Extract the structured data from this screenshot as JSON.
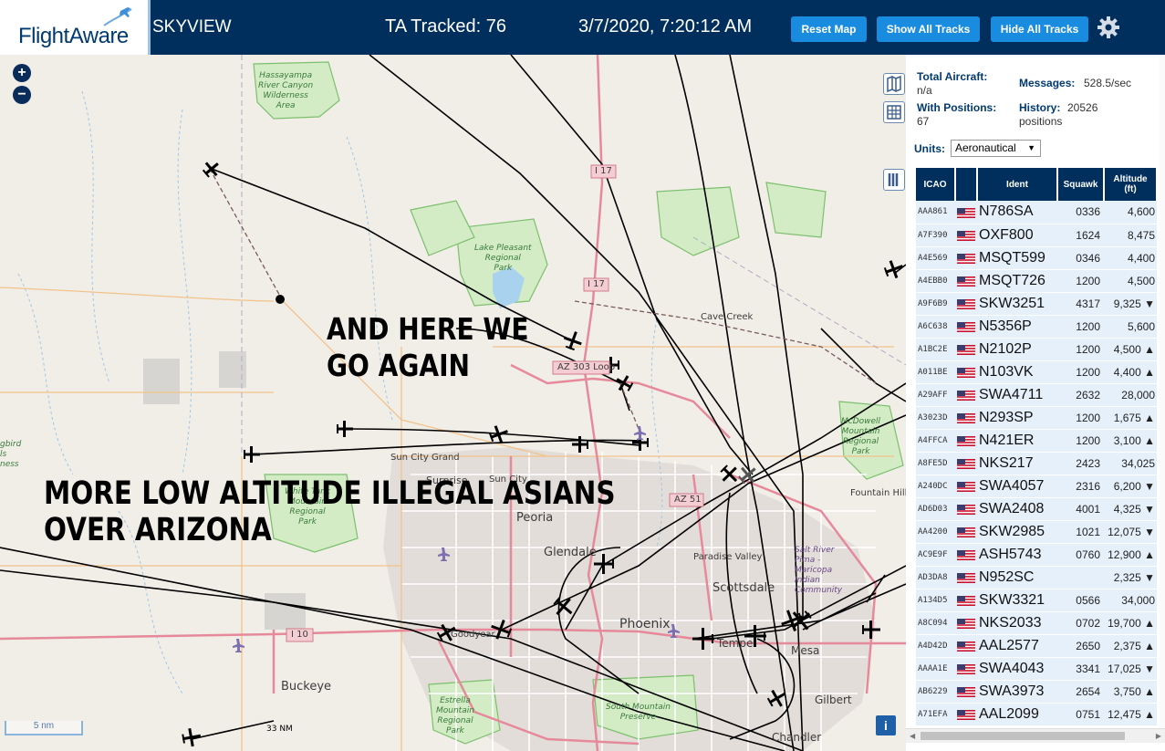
{
  "header": {
    "logo_text": "FlightAware",
    "app_name": "SKYVIEW",
    "tracked": "TA Tracked: 76",
    "datetime": "3/7/2020, 7:20:12 AM",
    "buttons": {
      "reset": "Reset Map",
      "show_all": "Show All Tracks",
      "hide_all": "Hide All Tracks"
    },
    "icons": {
      "settings": "gear-icon",
      "logo": "airplane-icon"
    }
  },
  "map": {
    "zoom_in": "+",
    "zoom_out": "−",
    "scale": "5 nm",
    "info": "i",
    "overlay_text_1": "AND HERE WE\nGO AGAIN",
    "overlay_text_2": "MORE LOW ALTITUDE ILLEGAL ASIANS\nOVER ARIZONA",
    "place_labels": {
      "cave_creek": "Cave Creek",
      "sun_city_grand": "Sun City Grand",
      "surprise": "Surprise",
      "sun_city": "Sun City",
      "peoria": "Peoria",
      "glendale": "Glendale",
      "paradise_valley": "Paradise Valley",
      "scottsdale": "Scottsdale",
      "phoenix": "Phoenix",
      "tempe": "Tempe",
      "mesa": "Mesa",
      "gilbert": "Gilbert",
      "chandler": "Chandler",
      "buckeye": "Buckeye",
      "goodyear": "Goodyear",
      "fountain_hills": "Fountain Hill",
      "salt_river": "Salt River\nPima -\nMaricopa\nIndian\nCommunity",
      "mileage": "33 NM"
    },
    "park_labels": {
      "hassayampa": "Hassayampa\nRiver Canyon\nWilderness\nArea",
      "lake_pleasant": "Lake Pleasant\nRegional\nPark",
      "white_tank": "White Tank\nMountain\nRegional\nPark",
      "mcdowell": "McDowell\nMountain\nRegional\nPark",
      "estrella": "Estrella\nMountain\nRegional\nPark",
      "south_mountain": "South Mountain\nPreserve",
      "skybird": "gbird\nls\nness"
    },
    "road_labels": {
      "i17_north": "I 17",
      "i17": "I 17",
      "az303": "AZ 303 Loop",
      "az51": "AZ 51",
      "i10": "I 10"
    }
  },
  "sidebar": {
    "total_aircraft_label": "Total Aircraft:",
    "total_aircraft_value": "n/a",
    "with_positions_label": "With Positions:",
    "with_positions_value": "67",
    "messages_label": "Messages:",
    "messages_value": "528.5/sec",
    "history_label": "History:",
    "history_value": "20526",
    "history_unit": "positions",
    "units_label": "Units:",
    "units_value": "Aeronautical",
    "table": {
      "headers": {
        "icao": "ICAO",
        "flag": "",
        "ident": "Ident",
        "squawk": "Squawk",
        "altitude": "Altitude\n(ft)"
      },
      "rows": [
        {
          "icao": "AAA861",
          "ident": "N786SA",
          "squawk": "0336",
          "altitude": "4,600"
        },
        {
          "icao": "A7F390",
          "ident": "OXF800",
          "squawk": "1624",
          "altitude": "8,475"
        },
        {
          "icao": "A4E569",
          "ident": "MSQT599",
          "squawk": "0346",
          "altitude": "4,400"
        },
        {
          "icao": "A4EBB0",
          "ident": "MSQT726",
          "squawk": "1200",
          "altitude": "4,500"
        },
        {
          "icao": "A9F6B9",
          "ident": "SKW3251",
          "squawk": "4317",
          "altitude": "9,325 ▼"
        },
        {
          "icao": "A6C638",
          "ident": "N5356P",
          "squawk": "1200",
          "altitude": "5,600"
        },
        {
          "icao": "A1BC2E",
          "ident": "N2102P",
          "squawk": "1200",
          "altitude": "4,500 ▲"
        },
        {
          "icao": "A011BE",
          "ident": "N103VK",
          "squawk": "1200",
          "altitude": "4,400 ▲"
        },
        {
          "icao": "A29AFF",
          "ident": "SWA4711",
          "squawk": "2632",
          "altitude": "28,000"
        },
        {
          "icao": "A3023D",
          "ident": "N293SP",
          "squawk": "1200",
          "altitude": "1,675 ▲"
        },
        {
          "icao": "A4FFCA",
          "ident": "N421ER",
          "squawk": "1200",
          "altitude": "3,100 ▲"
        },
        {
          "icao": "A8FE5D",
          "ident": "NKS217",
          "squawk": "2423",
          "altitude": "34,025"
        },
        {
          "icao": "A240DC",
          "ident": "SWA4057",
          "squawk": "2316",
          "altitude": "6,200 ▼"
        },
        {
          "icao": "AD6D03",
          "ident": "SWA2408",
          "squawk": "4001",
          "altitude": "4,325 ▼"
        },
        {
          "icao": "AA4200",
          "ident": "SKW2985",
          "squawk": "1021",
          "altitude": "12,075 ▼"
        },
        {
          "icao": "AC9E9F",
          "ident": "ASH5743",
          "squawk": "0760",
          "altitude": "12,900 ▲"
        },
        {
          "icao": "AD3DA8",
          "ident": "N952SC",
          "squawk": "",
          "altitude": "2,325 ▼"
        },
        {
          "icao": "A134D5",
          "ident": "SKW3321",
          "squawk": "0566",
          "altitude": "34,000"
        },
        {
          "icao": "A8C094",
          "ident": "NKS2033",
          "squawk": "0702",
          "altitude": "19,700 ▲"
        },
        {
          "icao": "A4D42D",
          "ident": "AAL2577",
          "squawk": "2650",
          "altitude": "2,375 ▲"
        },
        {
          "icao": "AAAA1E",
          "ident": "SWA4043",
          "squawk": "3341",
          "altitude": "17,025 ▼"
        },
        {
          "icao": "AB6229",
          "ident": "SWA3973",
          "squawk": "2654",
          "altitude": "3,750 ▲"
        },
        {
          "icao": "A71EFA",
          "ident": "AAL2099",
          "squawk": "0751",
          "altitude": "12,475 ▲"
        }
      ]
    }
  }
}
